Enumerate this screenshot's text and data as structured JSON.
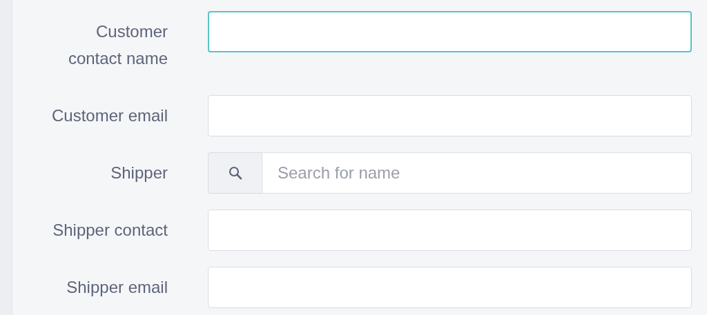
{
  "form": {
    "fields": [
      {
        "label": "Customer contact name",
        "kind": "text",
        "focused": true
      },
      {
        "label": "Customer email",
        "kind": "text",
        "focused": false
      },
      {
        "label": "Shipper",
        "kind": "search",
        "focused": false,
        "placeholder": "Search for name"
      },
      {
        "label": "Shipper contact",
        "kind": "text",
        "focused": false
      },
      {
        "label": "Shipper email",
        "kind": "text",
        "focused": false
      }
    ]
  }
}
